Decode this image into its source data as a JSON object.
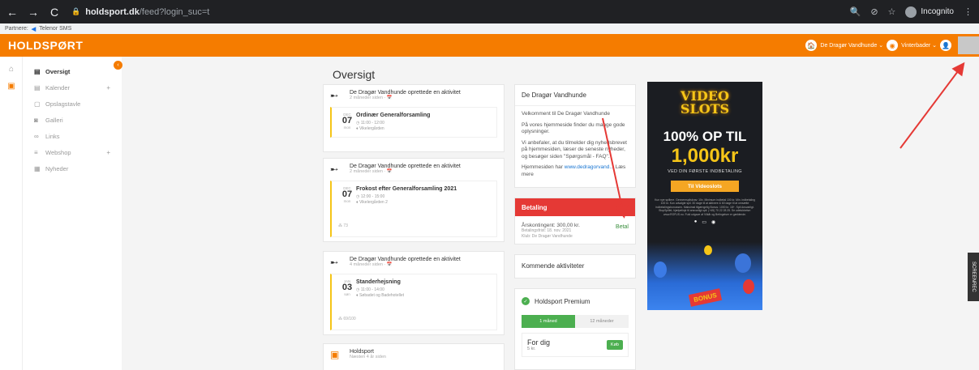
{
  "browser": {
    "domain": "holdsport.dk",
    "path": "/feed?login_suc=t",
    "incognito_label": "Incognito",
    "bookmarks": {
      "label": "Partnere:",
      "item": "Telenor SMS"
    }
  },
  "header": {
    "logo": "HOLDSPØRT",
    "team_label": "De Dragør Vandhunde ⌄",
    "team2_label": "Vinterbader ⌄"
  },
  "sidebar": {
    "items": [
      {
        "label": "Oversigt",
        "icon": "calendar-icon",
        "active": true,
        "plus": false
      },
      {
        "label": "Kalender",
        "icon": "calendar-icon",
        "active": false,
        "plus": true
      },
      {
        "label": "Opslagstavle",
        "icon": "board-icon",
        "active": false,
        "plus": false
      },
      {
        "label": "Galleri",
        "icon": "camera-icon",
        "active": false,
        "plus": false
      },
      {
        "label": "Links",
        "icon": "link-icon",
        "active": false,
        "plus": false
      },
      {
        "label": "Webshop",
        "icon": "cart-icon",
        "active": false,
        "plus": true
      },
      {
        "label": "Nyheder",
        "icon": "news-icon",
        "active": false,
        "plus": false
      }
    ]
  },
  "main": {
    "title": "Oversigt",
    "feed": [
      {
        "author": "De Dragør Vandhunde oprettede en aktivitet",
        "time": "2 måneder siden · 📅",
        "event": {
          "month": "DEC",
          "day": "07",
          "weekday": "mon",
          "title": "Ordinær Generalforsamling",
          "time": "11:00 - 12:00",
          "place": "Vikelergården"
        },
        "count": ""
      },
      {
        "author": "De Dragør Vandhunde oprettede en aktivitet",
        "time": "2 måneder siden · 📅",
        "event": {
          "month": "DEC",
          "day": "07",
          "weekday": "mon",
          "title": "Frokost efter Generalforsamling 2021",
          "time": "12:00 - 15:00",
          "place": "Vikelergården 2"
        },
        "count": "73"
      },
      {
        "author": "De Dragør Vandhunde oprettede en aktivitet",
        "time": "4 måneder siden · 📅",
        "event": {
          "month": "JAN",
          "day": "03",
          "weekday": "søn",
          "title": "Standerhejsning",
          "time": "11:00 - 14:00",
          "place": "Søbadet og Badehotellet"
        },
        "count": "69/100"
      },
      {
        "author": "Holdsport",
        "time": "Næsten 4 år siden",
        "event": null,
        "count": ""
      }
    ],
    "info": {
      "title": "De Dragør Vandhunde",
      "p1": "Velkomment til De Dragør Vandhunde",
      "p2": "På vores hjemmeside finder du mange gode oplysninger.",
      "p3": "Vi anbefaler, at du tilmelder dig nyhedsbrevet på hjemmesiden, læser de seneste nyheder, og besøger siden \"Spørgsmål - FAQ\".",
      "p4_prefix": "Hjemmesiden har ",
      "p4_link": "www.dedragorvand...",
      "p4_suffix": " Læs mere"
    },
    "payment": {
      "title": "Betaling",
      "item": "Årskontingent: 300,00 kr.",
      "deadline": "Betalingsfrist: 18. nov. 2021",
      "club": "Klub: De Dragør Vandhunde",
      "action": "Betal"
    },
    "upcoming": {
      "title": "Kommende aktiviteter"
    },
    "premium": {
      "title": "Holdsport Premium",
      "tabs": [
        "1 måned",
        "12 måneder"
      ],
      "plan_name": "For dig",
      "plan_price": "5 kr.",
      "buy": "Køb"
    }
  },
  "ad": {
    "logo_line1": "VIDEO",
    "logo_line2": "SLOTS",
    "line1": "100% OP TIL",
    "line2": "1,000kr",
    "line3": "VED DIN FØRSTE INDBETALING",
    "cta": "Til Videoslots",
    "fine": "Kun nye spillere. Gennemspilskrav: 10x. Minimum indbetal 100 kr. Min. indbetaling 100 kr. Kun udvalgte spil. 30 dage til at aktivere & 60 dage til at omsætte indbetalingsbonussen. Maksimal tilgængelig Bonus: 1000 kr. 18+. Spil Ansvarligt. StopSpillet, hjælpelinje til ansvarligt spil: (+45) 70 22 28 25. Se udelukkelse: www.ROFUS.nu. Fuld udgave af Vilkår og Betingelser er gældende.",
    "bonus": "BONUS"
  },
  "overlay": {
    "screenrec": "SCREENREC"
  }
}
